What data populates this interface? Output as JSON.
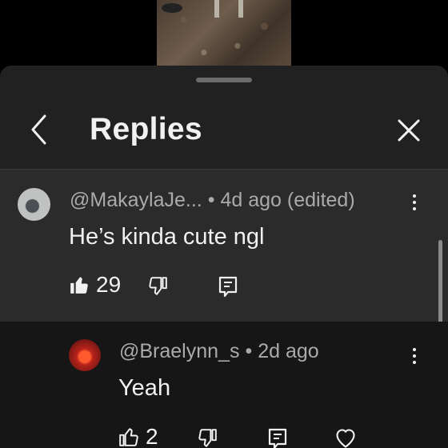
{
  "header": {
    "title": "Replies"
  },
  "parent_comment": {
    "author": "@MakaylaJe...",
    "separator": "•",
    "time": "4d ago (edited)",
    "text": "He’s kinda cute ngl",
    "like_count": "29",
    "creator_heart": true
  },
  "reply": {
    "author": "@Braelynn_s",
    "separator": "•",
    "time": "2d ago",
    "text": "Yeah",
    "like_count": "2"
  },
  "colors": {
    "background": "#000000",
    "sheet": "#212121",
    "highlight_row": "#2b2b2b",
    "text_primary": "#f1f1f1",
    "text_secondary": "#aaaaaa",
    "heart": "#e0162b"
  },
  "icons": {
    "back": "chevron-left-icon",
    "close": "close-icon",
    "more": "kebab-menu-icon",
    "like": "thumbs-up-icon",
    "dislike": "thumbs-down-icon",
    "reply": "reply-comment-icon",
    "heart": "heart-icon"
  }
}
